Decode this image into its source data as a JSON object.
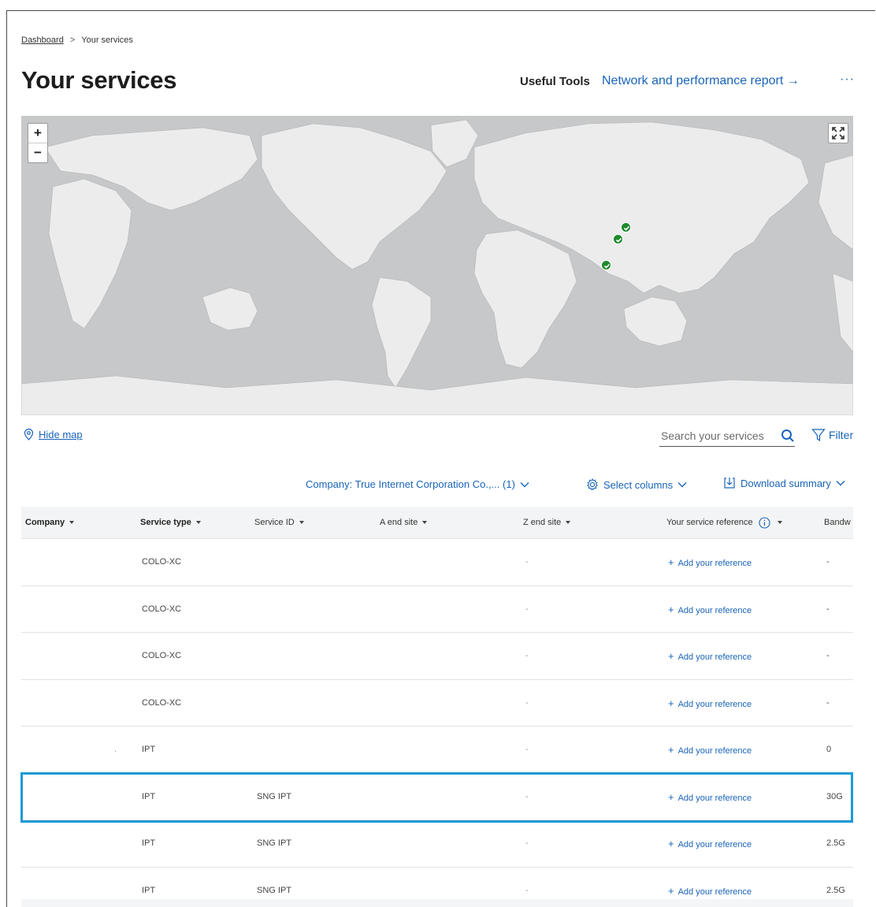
{
  "breadcrumb": {
    "home": "Dashboard",
    "separator": ">",
    "current": "Your services"
  },
  "page": {
    "title": "Your services"
  },
  "header": {
    "useful_tools": "Useful Tools",
    "report_link": "Network and performance report →",
    "more": "···"
  },
  "map": {
    "zoom_in": "+",
    "zoom_out": "−",
    "marker_color": "#1f8a2c",
    "land_color": "#ececec",
    "water_color": "#c6c8ca"
  },
  "controls": {
    "hide_map": "Hide map",
    "search_placeholder": "Search your services",
    "filter": "Filter",
    "company": "Company: True Internet Corporation Co.,... (1)",
    "select_columns": "Select columns",
    "download_summary": "Download summary"
  },
  "table": {
    "columns": [
      "Company",
      "Service type",
      "Service ID",
      "A end site",
      "Z end site",
      "Your service reference",
      "Bandw"
    ],
    "add_reference_label": "Add your reference",
    "rows": [
      {
        "company": "",
        "service_type": "COLO-XC",
        "service_id": "",
        "z_end": "-",
        "bandwidth": "-"
      },
      {
        "company": "",
        "service_type": "COLO-XC",
        "service_id": "",
        "z_end": "-",
        "bandwidth": "-"
      },
      {
        "company": "",
        "service_type": "COLO-XC",
        "service_id": "",
        "z_end": "-",
        "bandwidth": "-"
      },
      {
        "company": "",
        "service_type": "COLO-XC",
        "service_id": "",
        "z_end": "-",
        "bandwidth": "-"
      },
      {
        "company": ".",
        "service_type": "IPT",
        "service_id": "",
        "z_end": "-",
        "bandwidth": "0"
      },
      {
        "company": "",
        "service_type": "IPT",
        "service_id": "SNG IPT",
        "z_end": "-",
        "bandwidth": "30G"
      },
      {
        "company": "",
        "service_type": "IPT",
        "service_id": "SNG IPT",
        "z_end": "-",
        "bandwidth": "2.5G"
      },
      {
        "company": "",
        "service_type": "IPT",
        "service_id": "SNG IPT",
        "z_end": "-",
        "bandwidth": "2.5G"
      }
    ]
  },
  "highlight_color": "#1c9ad6",
  "link_color": "#1a64b8"
}
